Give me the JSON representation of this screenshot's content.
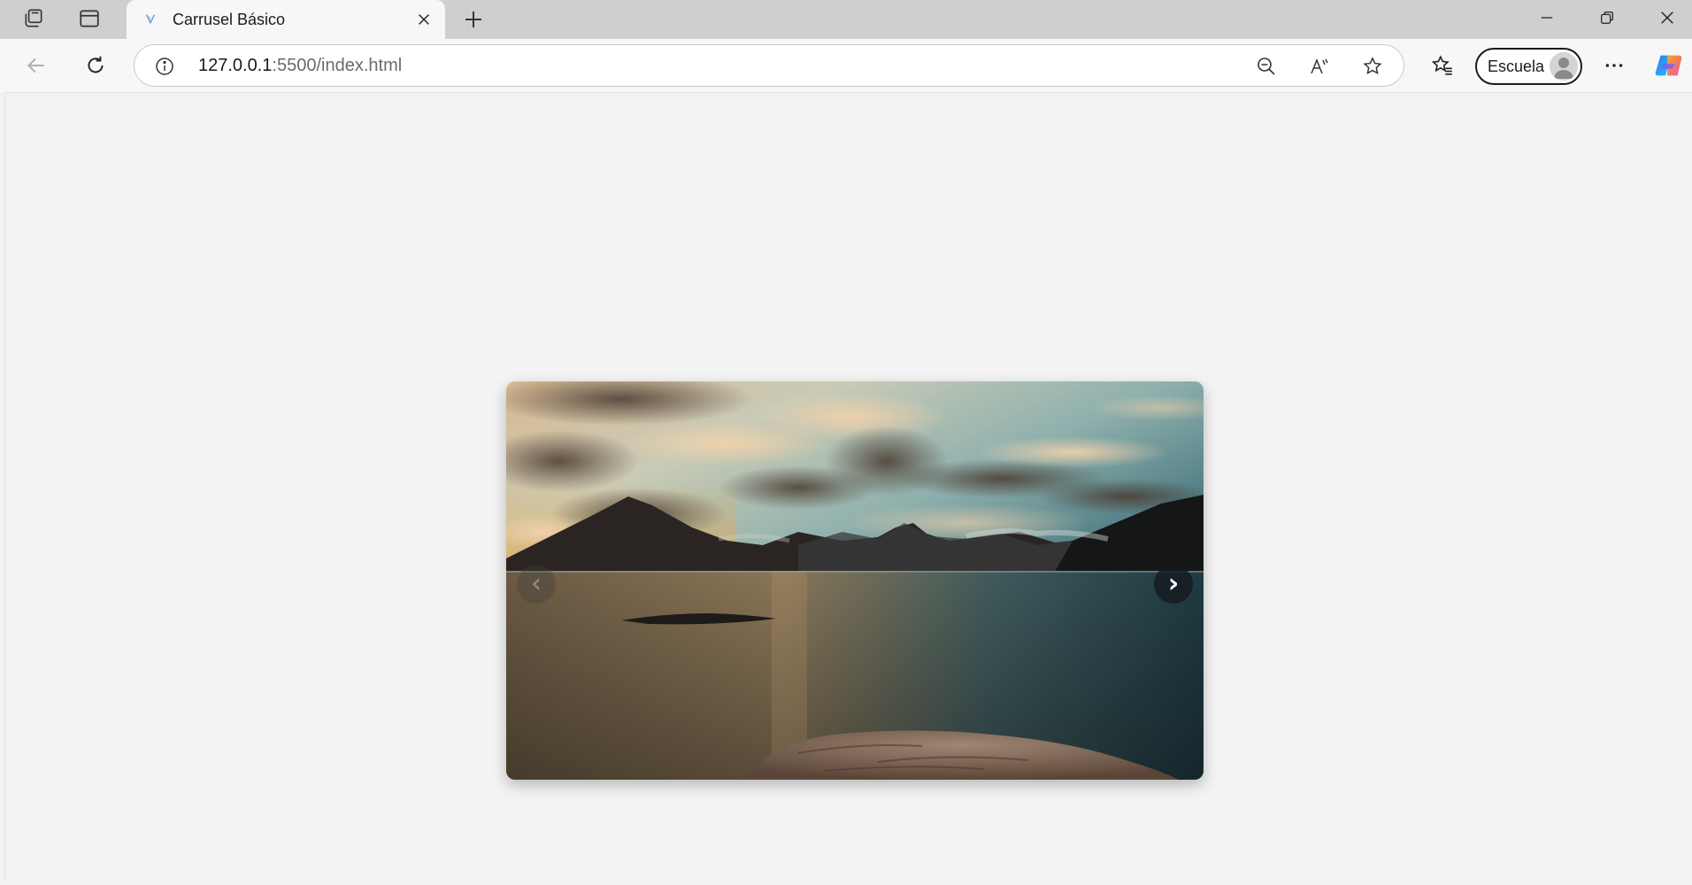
{
  "browser": {
    "tab": {
      "title": "Carrusel Básico",
      "close_icon": "close-icon"
    },
    "address": {
      "host": "127.0.0.1",
      "path": ":5500/index.html"
    },
    "profile": {
      "label": "Escuela"
    },
    "icons": {
      "workspaces": "workspaces-icon",
      "tab_actions": "vertical-tabs-icon",
      "new_tab": "plus-icon",
      "minimize": "minimize-icon",
      "restore": "restore-icon",
      "close_window": "close-icon",
      "back": "back-arrow-icon",
      "refresh": "refresh-icon",
      "site_info": "info-icon",
      "zoom": "zoom-out-icon",
      "read_aloud": "read-aloud-icon",
      "favorite": "star-icon",
      "favorites": "favorites-icon",
      "more": "more-icon",
      "copilot": "copilot-icon"
    }
  },
  "page": {
    "background": "#f3f3f3",
    "carousel": {
      "prev_label": "‹",
      "next_label": "›",
      "slide_image": "sunset-lake-mountains",
      "prev_enabled": false,
      "next_enabled": true
    }
  }
}
